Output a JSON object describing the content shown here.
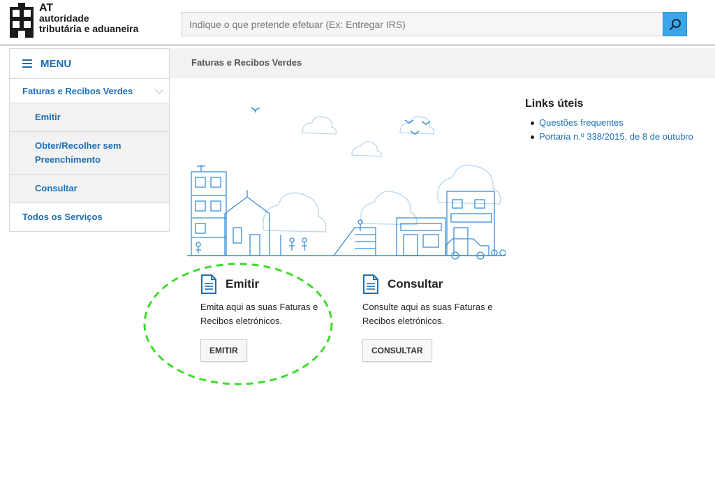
{
  "header": {
    "logo": {
      "short": "AT",
      "line1": "autoridade",
      "line2": "tributária e aduaneira"
    },
    "search": {
      "placeholder": "Indique o que pretende efetuar (Ex: Entregar IRS)",
      "icon": "search-icon"
    }
  },
  "breadcrumb": {
    "current": "Faturas e Recibos Verdes"
  },
  "sidebar": {
    "menu_label": "MENU",
    "items": [
      {
        "label": "Faturas e Recibos Verdes"
      },
      {
        "label": "Emitir"
      },
      {
        "label": "Obter/Recolher sem Preenchimento"
      },
      {
        "label": "Consultar"
      },
      {
        "label": "Todos os Serviços"
      }
    ]
  },
  "cards": {
    "emitir": {
      "title": "Emitir",
      "text": "Emita aqui as suas Faturas e Recibos eletrónicos.",
      "button": "EMITIR"
    },
    "consultar": {
      "title": "Consultar",
      "text": "Consulte aqui as suas Faturas e Recibos eletrónicos.",
      "button": "CONSULTAR"
    }
  },
  "links": {
    "title": "Links úteis",
    "items": [
      "Questões frequentes",
      "Portaria n.º 338/2015, de 8 de outubro"
    ]
  },
  "colors": {
    "brand_blue": "#1d6fb5",
    "search_button": "#3aa6e8",
    "highlight": "#3ddc2a"
  }
}
